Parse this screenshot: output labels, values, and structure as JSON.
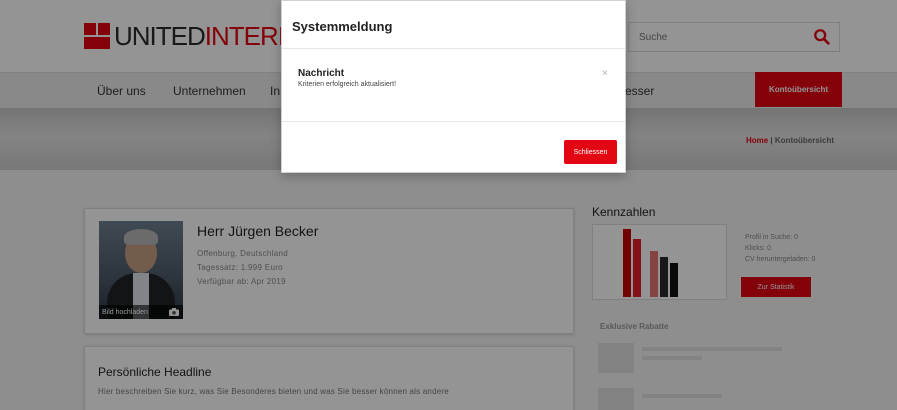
{
  "logo": {
    "text_dark": "UNITED",
    "text_red": "INTERIM"
  },
  "search": {
    "placeholder": "Suche"
  },
  "nav": {
    "items": [
      "Über uns",
      "Unternehmen",
      "In",
      "esser"
    ],
    "cta": "Kontoübersicht"
  },
  "breadcrumb": {
    "home": "Home",
    "separator": "|",
    "current": "Kontoübersicht"
  },
  "profile": {
    "name": "Herr Jürgen Becker",
    "location": "Offenburg, Deutschland",
    "rate": "Tagessatz: 1.999 Euro",
    "availability": "Verfügbar ab: Apr 2019",
    "photo_upload": "Bild hochladen"
  },
  "headline": {
    "title": "Persönliche Headline",
    "text": "Hier beschreiben Sie kurz, was Sie Besonderes bieten und was Sie besser können als andere"
  },
  "kpi": {
    "title": "Kennzahlen",
    "stats": [
      "Profil in Suche: 0",
      "Klicks: 0",
      "CV heruntergeladen: 0"
    ],
    "button": "Zur Statistik"
  },
  "rebates": {
    "title": "Exklusive Rabatte"
  },
  "modal": {
    "title": "Systemmeldung",
    "subtitle": "Nachricht",
    "message": "Kriterien erfolgreich aktualisiert!",
    "close_symbol": "×",
    "button": "Schliessen"
  },
  "colors": {
    "brand_red": "#e30613",
    "overlay": "rgba(0,0,0,0.42)"
  }
}
